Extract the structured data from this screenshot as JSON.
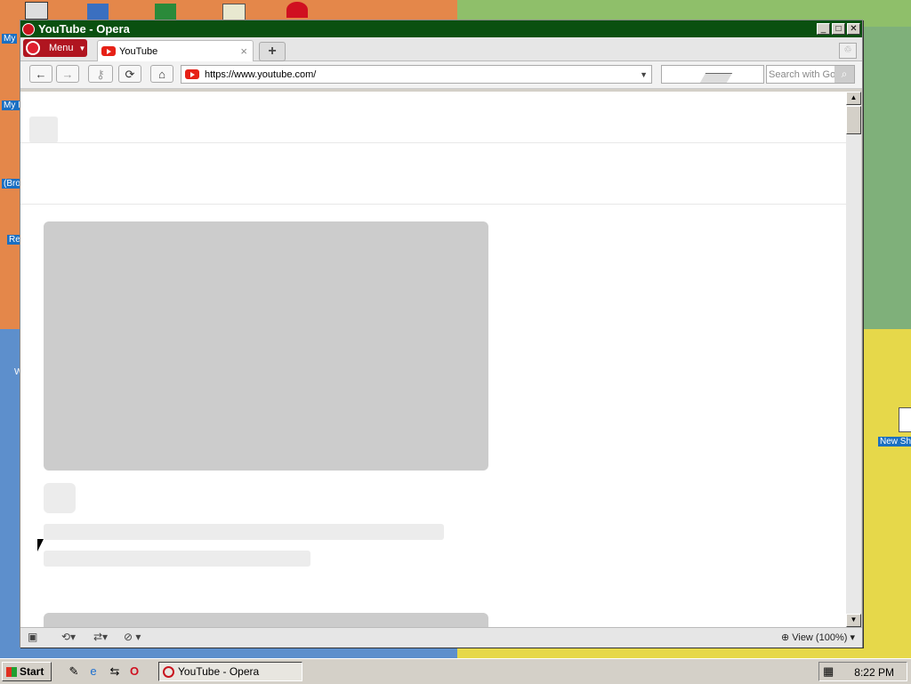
{
  "desktop": {
    "labels": [
      "My",
      "My I",
      "(Bro",
      "Re",
      "W",
      "New Sh"
    ]
  },
  "window": {
    "title": "YouTube - Opera",
    "controls": {
      "minimize": "_",
      "maximize": "□",
      "close": "✕"
    }
  },
  "tabs": {
    "menu_label": "Menu",
    "active_tab": {
      "label": "YouTube",
      "close": "×"
    },
    "new_tab": "+"
  },
  "navigation": {
    "back": "←",
    "forward": "→",
    "key": "⚷",
    "reload": "⟳",
    "home": "⌂",
    "url": "https://www.youtube.com/",
    "search_placeholder": "Search with Go"
  },
  "statusbar": {
    "zoom_label": "View (100%)"
  },
  "taskbar": {
    "start_label": "Start",
    "task_label": "YouTube - Opera",
    "clock": "8:22 PM"
  }
}
